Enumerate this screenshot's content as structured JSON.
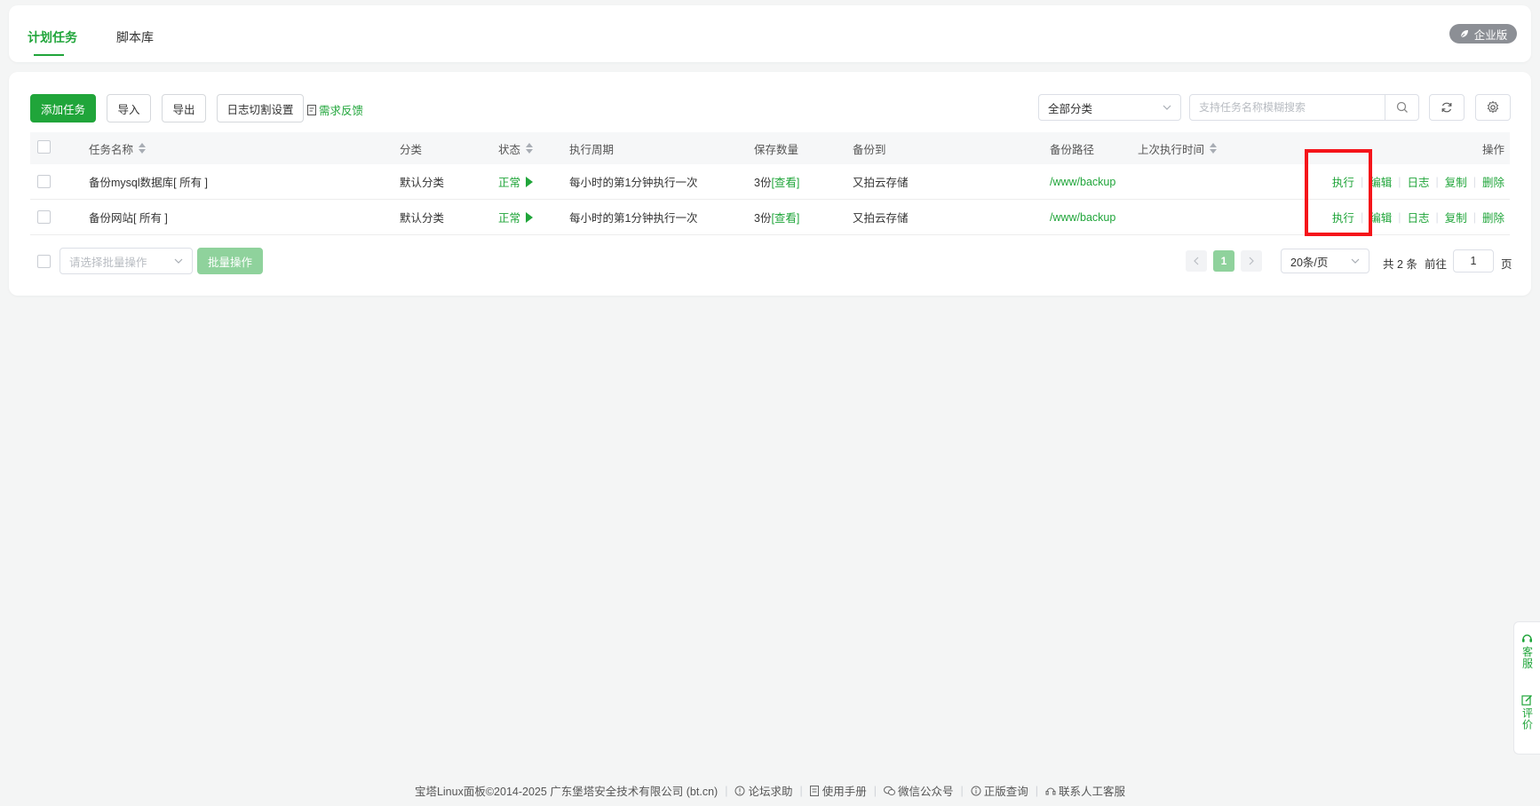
{
  "tabs": [
    {
      "label": "计划任务",
      "active": true
    },
    {
      "label": "脚本库",
      "active": false
    }
  ],
  "enterprise_badge": "企业版",
  "toolbar": {
    "add_task": "添加任务",
    "import": "导入",
    "export": "导出",
    "log_split": "日志切割设置",
    "feedback": "需求反馈",
    "category_select": "全部分类",
    "search_placeholder": "支持任务名称模糊搜索"
  },
  "table": {
    "headers": {
      "name": "任务名称",
      "category": "分类",
      "status": "状态",
      "cycle": "执行周期",
      "keep": "保存数量",
      "backup_to": "备份到",
      "backup_path": "备份路径",
      "last_run": "上次执行时间",
      "ops": "操作"
    },
    "rows": [
      {
        "name": "备份mysql数据库[ 所有 ]",
        "category": "默认分类",
        "status": "正常",
        "cycle": "每小时的第1分钟执行一次",
        "keep_count": "3份",
        "keep_view": "[查看]",
        "backup_to": "又拍云存储",
        "backup_path": "/www/backup",
        "last_run": ""
      },
      {
        "name": "备份网站[ 所有 ]",
        "category": "默认分类",
        "status": "正常",
        "cycle": "每小时的第1分钟执行一次",
        "keep_count": "3份",
        "keep_view": "[查看]",
        "backup_to": "又拍云存储",
        "backup_path": "/www/backup",
        "last_run": ""
      }
    ],
    "ops": {
      "run": "执行",
      "edit": "编辑",
      "log": "日志",
      "copy": "复制",
      "delete": "删除"
    }
  },
  "batch": {
    "select_placeholder": "请选择批量操作",
    "button": "批量操作"
  },
  "pager": {
    "current": "1",
    "page_size": "20条/页",
    "total": "共 2 条",
    "goto_label": "前往",
    "goto_value": "1",
    "page_unit": "页"
  },
  "footer": {
    "copyright": "宝塔Linux面板©2014-2025 广东堡塔安全技术有限公司 (bt.cn)",
    "forum": "论坛求助",
    "manual": "使用手册",
    "wechat": "微信公众号",
    "verify": "正版查询",
    "support": "联系人工客服"
  },
  "side": {
    "service": "客服",
    "review": "评价"
  },
  "colors": {
    "accent": "#20a53a",
    "highlight": "#f5141a"
  }
}
